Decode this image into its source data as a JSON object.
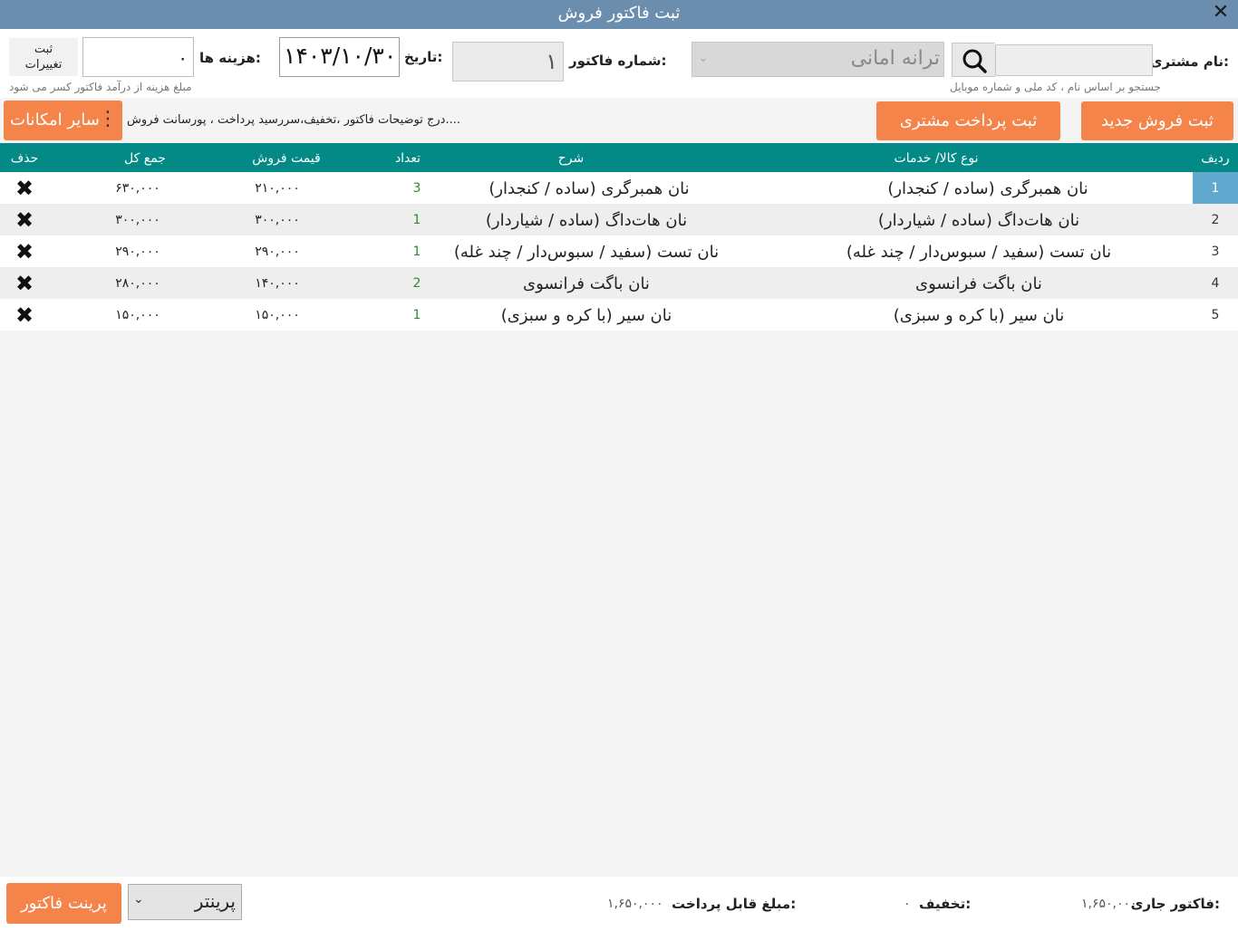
{
  "window": {
    "title": "ثبت فاکتور فروش"
  },
  "header": {
    "customer_label": "نام مشتری:",
    "customer_search_hint": "جستجو بر اساس نام ، کد ملی و شماره موبایل",
    "customer_selected": "ترانه امانی",
    "invoice_no_label": "شماره فاکتور:",
    "invoice_no": "۱",
    "date_label": "تاریخ:",
    "date": "۱۴۰۳/۱۰/۳۰",
    "cost_label": "هزینه ها:",
    "cost_value": "۰",
    "cost_hint": "مبلغ هزینه از درآمد فاکتور کسر می شود",
    "save_changes_label": "ثبت تغییرات"
  },
  "toolbar": {
    "new_sale": "ثبت فروش جدید",
    "customer_payment": "ثبت پرداخت مشتری",
    "description": "درج توضیحات فاکتور ،تخفیف،سررسید پرداخت ، پورسانت فروش....",
    "more_options": "سایر امکانات"
  },
  "table": {
    "headers": {
      "row": "ردیف",
      "type": "نوع کالا/ خدمات",
      "desc": "شرح",
      "qty": "تعداد",
      "price": "قیمت فروش",
      "total": "جمع کل",
      "delete": "حذف"
    },
    "rows": [
      {
        "idx": "1",
        "type": "نان همبرگری (ساده / کنجدار)",
        "desc": "نان همبرگری (ساده / کنجدار)",
        "qty": "3",
        "price": "۲۱۰,۰۰۰",
        "total": "۶۳۰,۰۰۰"
      },
      {
        "idx": "2",
        "type": "نان هات‌داگ (ساده / شیاردار)",
        "desc": "نان هات‌داگ (ساده / شیاردار)",
        "qty": "1",
        "price": "۳۰۰,۰۰۰",
        "total": "۳۰۰,۰۰۰"
      },
      {
        "idx": "3",
        "type": "نان تست (سفید / سبوس‌دار / چند غله)",
        "desc": "نان تست (سفید / سبوس‌دار / چند غله)",
        "qty": "1",
        "price": "۲۹۰,۰۰۰",
        "total": "۲۹۰,۰۰۰"
      },
      {
        "idx": "4",
        "type": "نان باگت فرانسوی",
        "desc": "نان باگت فرانسوی",
        "qty": "2",
        "price": "۱۴۰,۰۰۰",
        "total": "۲۸۰,۰۰۰"
      },
      {
        "idx": "5",
        "type": "نان سیر (با کره و سبزی)",
        "desc": "نان سیر (با کره و سبزی)",
        "qty": "1",
        "price": "۱۵۰,۰۰۰",
        "total": "۱۵۰,۰۰۰"
      }
    ]
  },
  "footer": {
    "current_invoice_label": "فاکتور جاری:",
    "current_invoice_value": "۱,۶۵۰,۰۰۰",
    "discount_label": "تخفیف:",
    "discount_value": "۰",
    "payable_label": "مبلغ قابل پرداخت:",
    "payable_value": "۱,۶۵۰,۰۰۰",
    "printer_selected": "پرینتر",
    "print_button": "پرینت فاکتور"
  },
  "colors": {
    "titlebar": "#6b8eaf",
    "accent_orange": "#f5844b",
    "table_header": "#048a86",
    "active_row_index": "#5fa9cf"
  }
}
